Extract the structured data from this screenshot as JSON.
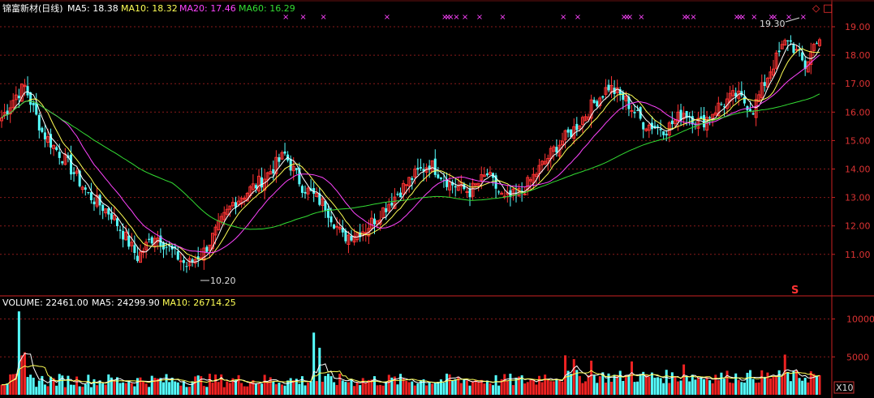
{
  "chart_data": [
    {
      "type": "candlestick",
      "title": "锦富新材(日线)",
      "ma_labels": [
        {
          "name": "MA5",
          "value": "18.38",
          "color": "#ffffff"
        },
        {
          "name": "MA10",
          "value": "18.32",
          "color": "#ffff55"
        },
        {
          "name": "MA20",
          "value": "17.46",
          "color": "#ff44ff"
        },
        {
          "name": "MA60",
          "value": "16.29",
          "color": "#33dd33"
        }
      ],
      "ylim": [
        10,
        19.5
      ],
      "yticks": [
        "19.00",
        "18.00",
        "17.00",
        "16.00",
        "15.00",
        "14.00",
        "13.00",
        "12.00",
        "11.00"
      ],
      "high_annotation": "19.30",
      "low_annotation": "10.20",
      "marker_symbol": "×",
      "s_label": "S",
      "corner_icons": [
        "◇",
        "□"
      ],
      "close_anchors": [
        [
          0,
          15.8
        ],
        [
          5,
          16.6
        ],
        [
          8,
          16.9
        ],
        [
          14,
          15.3
        ],
        [
          22,
          14.3
        ],
        [
          30,
          13.1
        ],
        [
          38,
          12.4
        ],
        [
          47,
          10.9
        ],
        [
          53,
          11.7
        ],
        [
          58,
          11.2
        ],
        [
          64,
          10.6
        ],
        [
          70,
          11.1
        ],
        [
          80,
          12.8
        ],
        [
          90,
          13.6
        ],
        [
          98,
          14.5
        ],
        [
          104,
          13.4
        ],
        [
          112,
          12.7
        ],
        [
          118,
          11.6
        ],
        [
          126,
          11.9
        ],
        [
          134,
          12.8
        ],
        [
          142,
          13.7
        ],
        [
          148,
          14.2
        ],
        [
          155,
          13.5
        ],
        [
          162,
          13.2
        ],
        [
          168,
          13.8
        ],
        [
          174,
          12.9
        ],
        [
          180,
          13.2
        ],
        [
          186,
          14.0
        ],
        [
          192,
          14.8
        ],
        [
          198,
          15.4
        ],
        [
          204,
          16.2
        ],
        [
          210,
          16.9
        ],
        [
          216,
          16.4
        ],
        [
          222,
          15.6
        ],
        [
          230,
          15.4
        ],
        [
          236,
          16.0
        ],
        [
          242,
          15.6
        ],
        [
          248,
          16.2
        ],
        [
          254,
          16.6
        ],
        [
          260,
          16.1
        ],
        [
          266,
          17.5
        ],
        [
          272,
          18.6
        ],
        [
          278,
          17.6
        ],
        [
          282,
          18.6
        ]
      ],
      "x_markers": [
        98,
        104,
        111,
        133,
        153,
        154,
        155,
        157,
        160,
        165,
        173,
        194,
        199,
        215,
        216,
        217,
        221,
        236,
        237,
        239,
        254,
        255,
        256,
        260,
        266,
        267,
        272,
        277
      ]
    },
    {
      "type": "bar",
      "title": "VOLUME",
      "value": "22461.00",
      "ma_labels": [
        {
          "name": "MA5",
          "value": "24299.90",
          "color": "#ffffff"
        },
        {
          "name": "MA10",
          "value": "26714.25",
          "color": "#ffff55"
        }
      ],
      "ylim": [
        0,
        12000
      ],
      "yticks": [
        "10000",
        "5000"
      ],
      "unit_label": "X10",
      "spikes": [
        [
          6,
          11000
        ],
        [
          7,
          5200
        ],
        [
          8,
          5600
        ],
        [
          108,
          8200
        ],
        [
          110,
          6200
        ],
        [
          195,
          5200
        ],
        [
          198,
          4700
        ],
        [
          204,
          4500
        ],
        [
          218,
          4400
        ],
        [
          236,
          4000
        ],
        [
          271,
          5300
        ],
        [
          280,
          3100
        ]
      ]
    }
  ]
}
